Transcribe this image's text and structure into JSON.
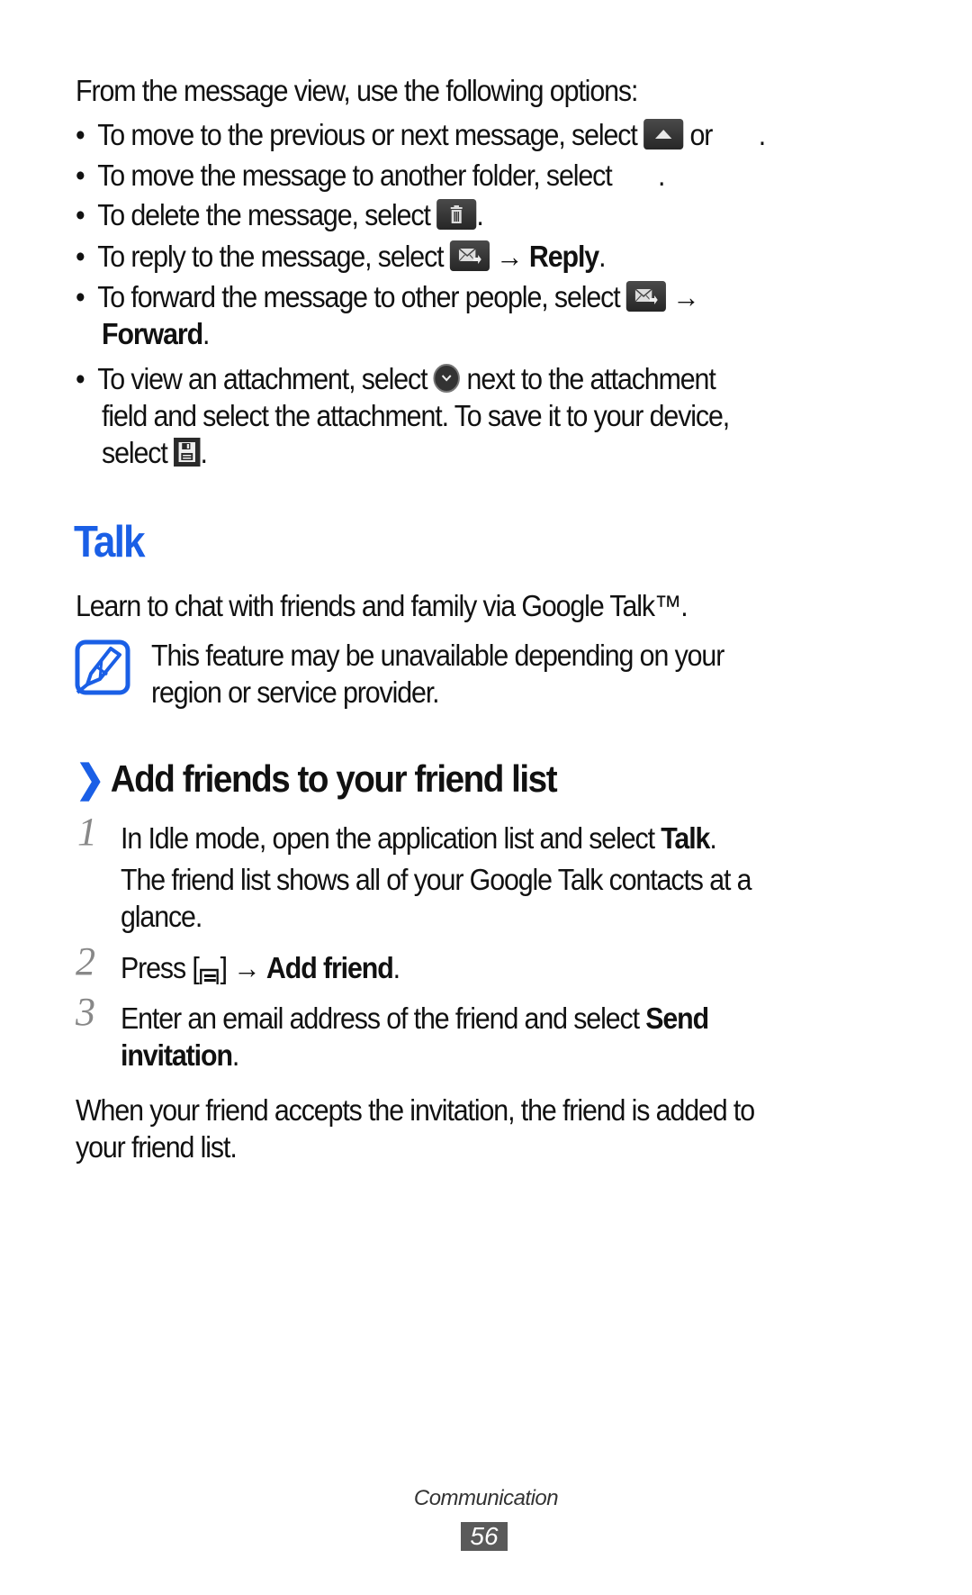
{
  "intro": "From the message view, use the following options:",
  "bullets": [
    {
      "pre": "To move to the previous or next message, select",
      "icon1": "up-arrow-icon",
      "mid": "or",
      "icon2": "down-arrow-icon (not rendered)",
      "post": "."
    },
    {
      "pre": "To move the message to another folder, select",
      "icon": "move-folder-icon (not rendered)",
      "post": "."
    },
    {
      "pre": "To delete the message, select",
      "icon": "trash-icon",
      "post": "."
    },
    {
      "pre": "To reply to the message, select",
      "icon": "reply-mail-icon",
      "arrow": "→",
      "bold": "Reply",
      "post": "."
    },
    {
      "pre": "To forward the message to other people, select",
      "icon": "forward-mail-icon",
      "arrow": "→",
      "bold": "Forward",
      "post": "."
    },
    {
      "pre": "To view an attachment, select",
      "icon": "chevron-down-circle-icon",
      "line1_post": "next to the attachment",
      "line2": "field and select the attachment. To save it to your device,",
      "line3_pre": "select",
      "icon2": "save-icon",
      "post": "."
    }
  ],
  "bullet_char": "•",
  "section": {
    "title": "Talk",
    "description": "Learn to chat with friends and family via Google Talk™.",
    "note": {
      "icon": "note-pencil-icon",
      "line1": "This feature may be unavailable depending on your",
      "line2": "region or service provider."
    }
  },
  "subsection": {
    "chevron": "❯",
    "title": "Add friends to your friend list",
    "steps": [
      {
        "num": "1",
        "pre": "In Idle mode, open the application list and select",
        "bold": "Talk",
        "post": ".",
        "extra_line1": "The friend list shows all of your Google Talk contacts at a",
        "extra_line2": "glance."
      },
      {
        "num": "2",
        "pre": "Press [",
        "icon": "menu-key-icon",
        "mid": "] →",
        "bold": "Add friend",
        "post": "."
      },
      {
        "num": "3",
        "pre": "Enter an email address of the friend and select",
        "bold1": "Send",
        "bold2": "invitation",
        "post": "."
      }
    ],
    "closing_line1": "When your friend accepts the invitation, the friend is added to",
    "closing_line2": "your friend list."
  },
  "footer": {
    "section": "Communication",
    "page": "56"
  },
  "colors": {
    "accent": "#1a5fe6",
    "text": "#111111",
    "step_number": "#888888",
    "page_badge": "#5a5a5a"
  }
}
